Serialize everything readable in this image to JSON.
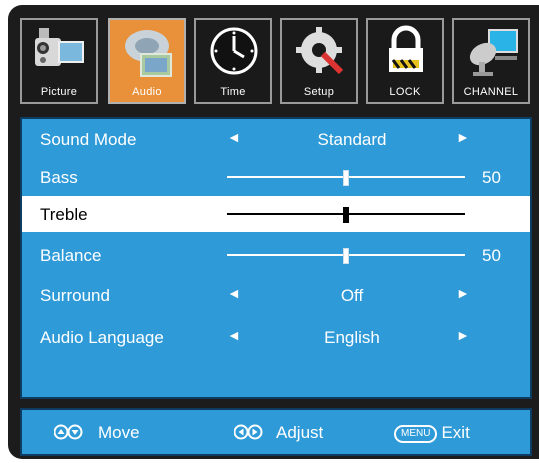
{
  "tabs": [
    {
      "label": "Picture",
      "icon": "picture-icon",
      "active": false
    },
    {
      "label": "Audio",
      "icon": "audio-icon",
      "active": true
    },
    {
      "label": "Time",
      "icon": "clock-icon",
      "active": false
    },
    {
      "label": "Setup",
      "icon": "setup-gear-icon",
      "active": false
    },
    {
      "label": "LOCK",
      "icon": "lock-icon",
      "active": false
    },
    {
      "label": "CHANNEL",
      "icon": "satellite-dish-icon",
      "active": false
    }
  ],
  "menu": {
    "sound_mode": {
      "label": "Sound Mode",
      "value": "Standard"
    },
    "bass": {
      "label": "Bass",
      "value": "50",
      "level": 0.5
    },
    "treble": {
      "label": "Treble",
      "level": 0.5
    },
    "balance": {
      "label": "Balance",
      "value": "50",
      "level": 0.5
    },
    "surround": {
      "label": "Surround",
      "value": "Off"
    },
    "audio_language": {
      "label": "Audio Language",
      "value": "English"
    }
  },
  "footer": {
    "move": "Move",
    "adjust": "Adjust",
    "menu_key": "MENU",
    "exit": "Exit"
  },
  "colors": {
    "panel": "#2f9ad8",
    "active_tab": "#e8903a",
    "frame": "#1c1c1c",
    "selected_row": "#ffffff"
  }
}
